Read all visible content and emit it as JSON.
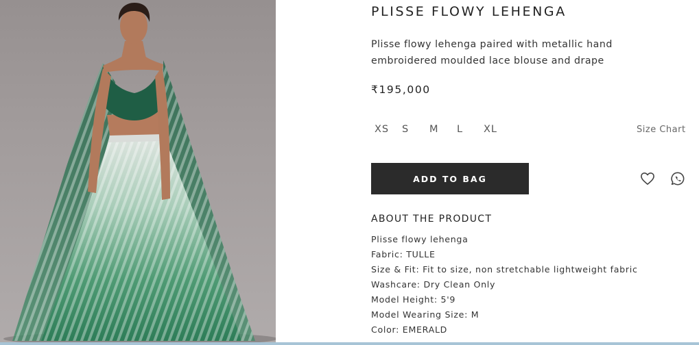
{
  "product": {
    "title": "PLISSE FLOWY LEHENGA",
    "description": "Plisse flowy lehenga paired with metallic hand embroidered moulded lace blouse and drape",
    "price": "₹195,000",
    "image_alt": "Model wearing emerald green plisse flowy lehenga with cape drape"
  },
  "sizes": {
    "options": [
      "XS",
      "S",
      "M",
      "L",
      "XL"
    ],
    "size_chart_label": "Size Chart"
  },
  "actions": {
    "add_to_bag_label": "ADD TO BAG",
    "wishlist_icon": "heart-icon",
    "share_icon": "whatsapp-icon"
  },
  "about": {
    "heading": "ABOUT THE PRODUCT",
    "items": [
      "Plisse flowy lehenga",
      "Fabric: TULLE",
      "Size & Fit: Fit to size, non stretchable lightweight fabric",
      "Washcare: Dry Clean Only",
      "Model Height: 5'9",
      "Model Wearing Size: M",
      "Color: EMERALD"
    ]
  },
  "colors": {
    "button_bg": "#2b2b2b",
    "emerald": "#1f5e45",
    "backdrop": "#a29c9c"
  }
}
